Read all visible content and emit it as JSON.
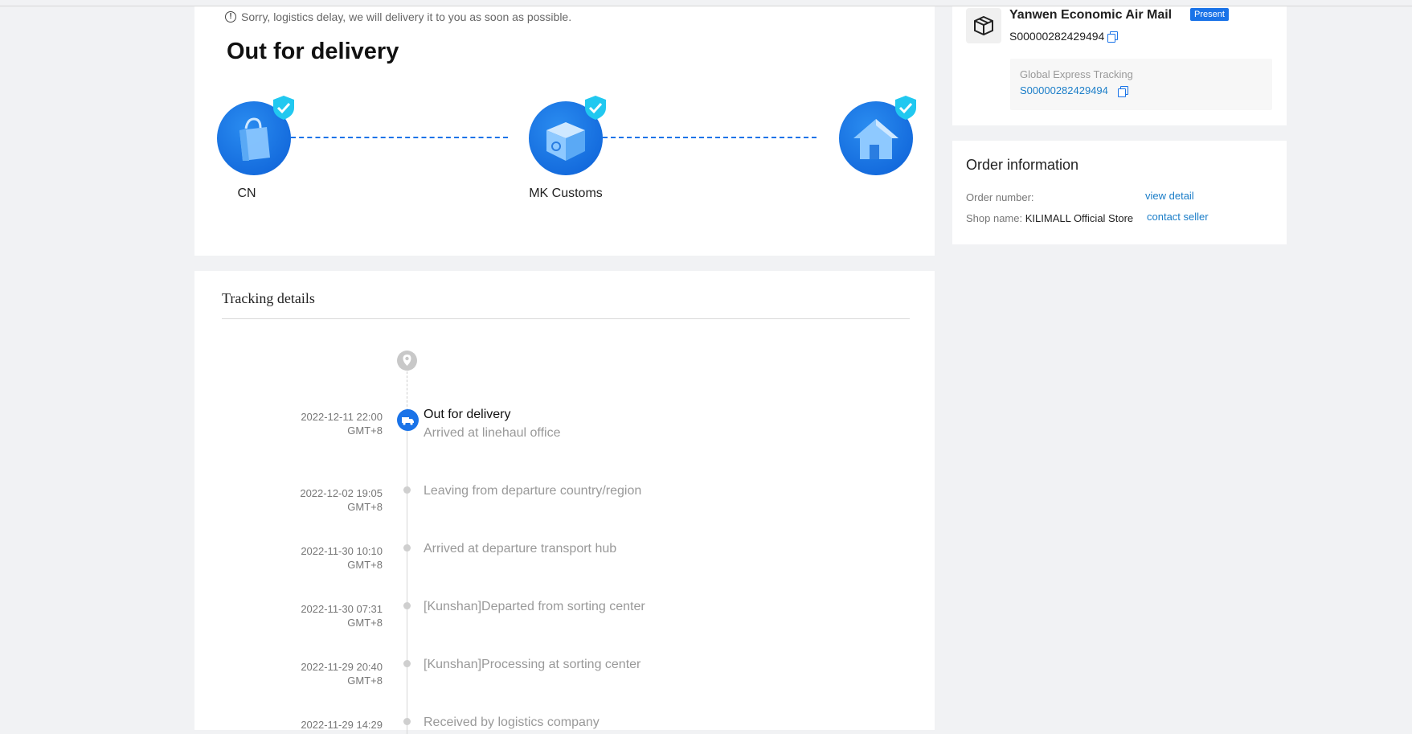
{
  "status": {
    "notice": "Sorry, logistics delay, we will delivery it to you as soon as possible.",
    "title": "Out for delivery",
    "nodes": [
      {
        "label": "CN",
        "icon": "shopping-bag-icon"
      },
      {
        "label": "MK Customs",
        "icon": "customs-box-icon"
      },
      {
        "label": "",
        "icon": "house-icon"
      }
    ]
  },
  "tracking": {
    "title": "Tracking details",
    "events": [
      {
        "date": "2022-12-11 22:00",
        "tz": "GMT+8",
        "title": "Out for delivery",
        "sub": "Arrived at linehaul office"
      },
      {
        "date": "2022-12-02 19:05",
        "tz": "GMT+8",
        "title": "Leaving from departure country/region"
      },
      {
        "date": "2022-11-30 10:10",
        "tz": "GMT+8",
        "title": "Arrived at departure transport hub"
      },
      {
        "date": "2022-11-30 07:31",
        "tz": "GMT+8",
        "title": "[Kunshan]Departed from sorting center"
      },
      {
        "date": "2022-11-29 20:40",
        "tz": "GMT+8",
        "title": "[Kunshan]Processing at sorting center"
      },
      {
        "date": "2022-11-29 14:29",
        "tz": "",
        "title": "Received by logistics company"
      }
    ]
  },
  "carrier": {
    "name": "Yanwen Economic Air Mail",
    "badge": "Present",
    "tracking_number": "S00000282429494",
    "global_label": "Global Express Tracking",
    "global_number": "S00000282429494"
  },
  "order": {
    "title": "Order information",
    "number_label": "Order number:",
    "view_detail": "view detail",
    "shop_label": "Shop name:",
    "shop_name": "KILIMALL Official Store",
    "contact_seller": "contact seller"
  },
  "colors": {
    "accent": "#1a73e8",
    "link": "#1a7dc8",
    "background": "#f1f2f4"
  }
}
